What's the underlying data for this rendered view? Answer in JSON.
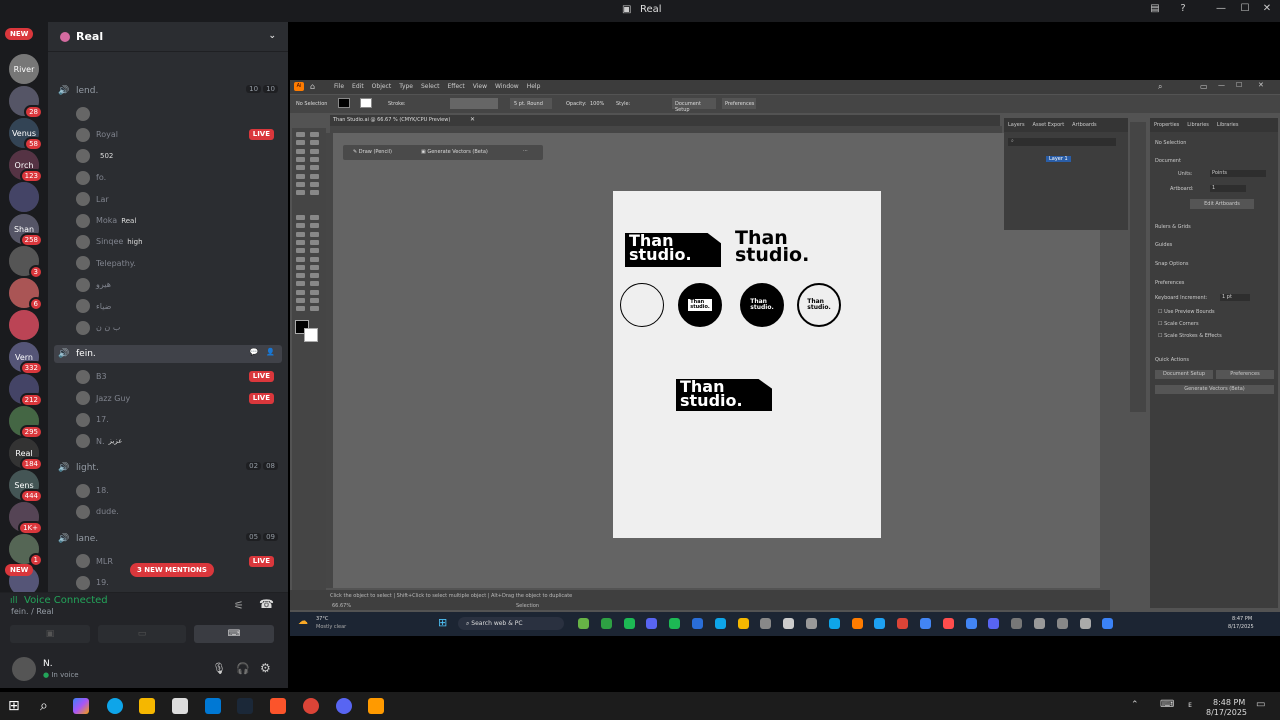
{
  "window": {
    "title": "Real"
  },
  "rail": {
    "new_top": "NEW",
    "new_bottom": "NEW",
    "servers": [
      {
        "label": "River",
        "count": "",
        "color": "#777"
      },
      {
        "label": "",
        "count": "28",
        "color": "#556"
      },
      {
        "label": "Venus",
        "count": "58",
        "color": "#345"
      },
      {
        "label": "Orch",
        "count": "123",
        "color": "#534"
      },
      {
        "label": "",
        "count": "",
        "color": "#446"
      },
      {
        "label": "Shan",
        "count": "258",
        "color": "#556"
      },
      {
        "label": "",
        "count": "3",
        "color": "#555"
      },
      {
        "label": "",
        "count": "6",
        "color": "#a55"
      },
      {
        "label": "",
        "count": "",
        "color": "#b45"
      },
      {
        "label": "Vern",
        "count": "332",
        "color": "#557"
      },
      {
        "label": "",
        "count": "212",
        "color": "#446"
      },
      {
        "label": "",
        "count": "295",
        "color": "#464"
      },
      {
        "label": "Real",
        "count": "184",
        "color": "#333"
      },
      {
        "label": "Sens",
        "count": "444",
        "color": "#455"
      },
      {
        "label": "",
        "count": "1K+",
        "color": "#545"
      },
      {
        "label": "",
        "count": "1",
        "color": "#565"
      },
      {
        "label": "",
        "count": "",
        "color": "#557"
      }
    ]
  },
  "sidebar": {
    "server_name": "Real",
    "channels": [
      {
        "name": "lend.",
        "counts": [
          "10",
          "10"
        ],
        "users": [
          {
            "name": "",
            "tag": "",
            "live": false
          },
          {
            "name": "Royal",
            "tag": "",
            "live": true
          },
          {
            "name": "",
            "tag": "502",
            "live": false
          },
          {
            "name": "fo.",
            "tag": "",
            "live": false
          },
          {
            "name": "Lar",
            "tag": "",
            "live": false
          },
          {
            "name": "Moka",
            "tag": "Real",
            "live": false
          },
          {
            "name": "Sinqee",
            "tag": "high",
            "live": false
          },
          {
            "name": "Telepathy.",
            "tag": "",
            "live": false
          },
          {
            "name": "هيرو",
            "tag": "",
            "live": false
          },
          {
            "name": "ضياء",
            "tag": "",
            "live": false
          },
          {
            "name": "ب ن ن",
            "tag": "",
            "live": false
          }
        ]
      },
      {
        "name": "fein.",
        "counts": [],
        "users": [
          {
            "name": "B3",
            "tag": "",
            "live": true
          },
          {
            "name": "Jazz Guy",
            "tag": "",
            "live": true
          },
          {
            "name": "17.",
            "tag": "",
            "live": false
          },
          {
            "name": "N.",
            "tag": "عزيز",
            "live": false
          }
        ]
      },
      {
        "name": "light.",
        "counts": [
          "02",
          "08"
        ],
        "users": [
          {
            "name": "18.",
            "tag": "",
            "live": false
          },
          {
            "name": "dude.",
            "tag": "",
            "live": false
          }
        ]
      },
      {
        "name": "lane.",
        "counts": [
          "05",
          "09"
        ],
        "users": [
          {
            "name": "MLR",
            "tag": "",
            "live": true
          },
          {
            "name": "19.",
            "tag": "",
            "live": false
          },
          {
            "name": "Crusty Crab",
            "tag": "",
            "live": false
          }
        ]
      }
    ],
    "live_label": "LIVE",
    "mentions": "3 NEW MENTIONS"
  },
  "voice": {
    "status": "Voice Connected",
    "location": "fein. / Real"
  },
  "user": {
    "name": "N.",
    "status": "In voice"
  },
  "illustrator": {
    "menu": [
      "File",
      "Edit",
      "Object",
      "Type",
      "Select",
      "Effect",
      "View",
      "Window",
      "Help"
    ],
    "control": {
      "no_selection": "No Selection",
      "stroke": "Stroke:",
      "brush": "5 pt. Round",
      "opacity": "Opacity:",
      "opacity_val": "100%",
      "style": "Style:",
      "doc_setup": "Document Setup",
      "prefs": "Preferences"
    },
    "doc_tab": "Than Studio.ai @ 66.67 % (CMYK/CPU Preview)",
    "contextual": {
      "draw": "Draw (Pencil)",
      "generate": "Generate Vectors (Beta)"
    },
    "logo_line1": "Than",
    "logo_line2": "studio.",
    "layers_tabs": [
      "Layers",
      "Asset Export",
      "Artboards"
    ],
    "layer_name": "Layer 1",
    "props_tabs": [
      "Properties",
      "Libraries",
      "Libraries"
    ],
    "props": {
      "no_sel": "No Selection",
      "document": "Document",
      "units": "Units:",
      "units_val": "Points",
      "artboard": "Artboard:",
      "artboard_val": "1",
      "edit_artboards": "Edit Artboards",
      "rulers": "Rulers & Grids",
      "guides": "Guides",
      "snap": "Snap Options",
      "preferences": "Preferences",
      "kb_inc": "Keyboard Increment:",
      "kb_val": "1 pt",
      "preview_bounds": "Use Preview Bounds",
      "scale_corners": "Scale Corners",
      "scale_strokes": "Scale Strokes & Effects",
      "quick_actions": "Quick Actions",
      "doc_setup": "Document Setup",
      "prefs": "Preferences",
      "gen_vec": "Generate Vectors (Beta)"
    },
    "status": "Click the object to select | Shift+Click to select multiple object | Alt+Drag the object to duplicate",
    "status_zoom": "66.67%",
    "status_tool": "Selection"
  },
  "inner_taskbar": {
    "weather_temp": "37°C",
    "weather_desc": "Mostly clear",
    "search": "Search web & PC",
    "time": "8:47 PM",
    "date": "8/17/2025"
  },
  "taskbar": {
    "time": "8:48 PM",
    "date": "8/17/2025"
  }
}
